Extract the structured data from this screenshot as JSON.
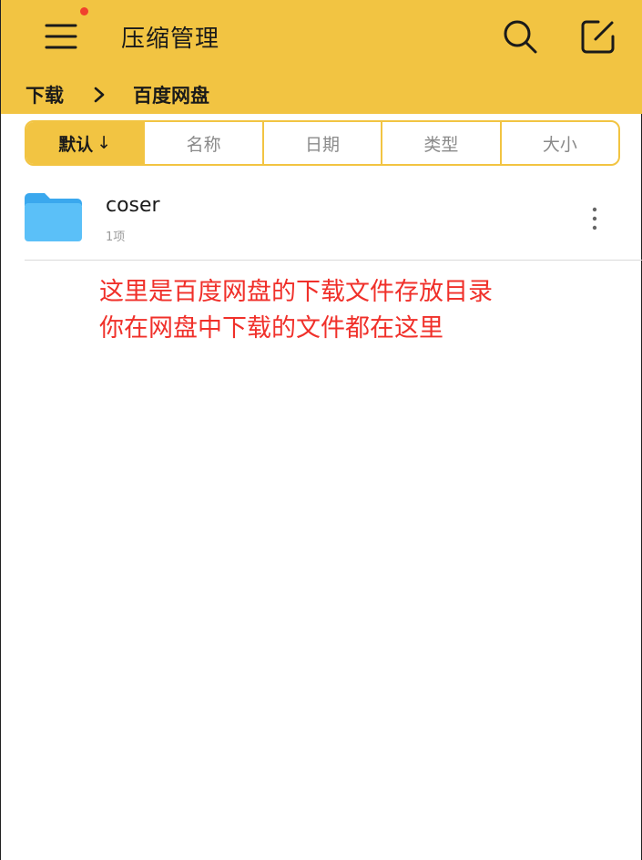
{
  "app": {
    "title": "压缩管理"
  },
  "breadcrumb": {
    "items": [
      "下载",
      "百度网盘"
    ]
  },
  "sort": {
    "tabs": [
      {
        "label": "默认",
        "arrow": "↓"
      },
      {
        "label": "名称"
      },
      {
        "label": "日期"
      },
      {
        "label": "类型"
      },
      {
        "label": "大小"
      }
    ]
  },
  "files": [
    {
      "name": "coser",
      "meta": "1项",
      "icon": "folder-icon"
    }
  ],
  "annotation": {
    "line1": "这里是百度网盘的下载文件存放目录",
    "line2": "你在网盘中下载的文件都在这里"
  },
  "colors": {
    "accent": "#F2C442",
    "notification": "#F0412D",
    "annotation": "#F0302A",
    "folder": "#5BC0F8"
  },
  "icons": [
    "menu-icon",
    "search-icon",
    "edit-icon",
    "chevron-right-icon",
    "folder-icon",
    "more-vertical-icon"
  ]
}
